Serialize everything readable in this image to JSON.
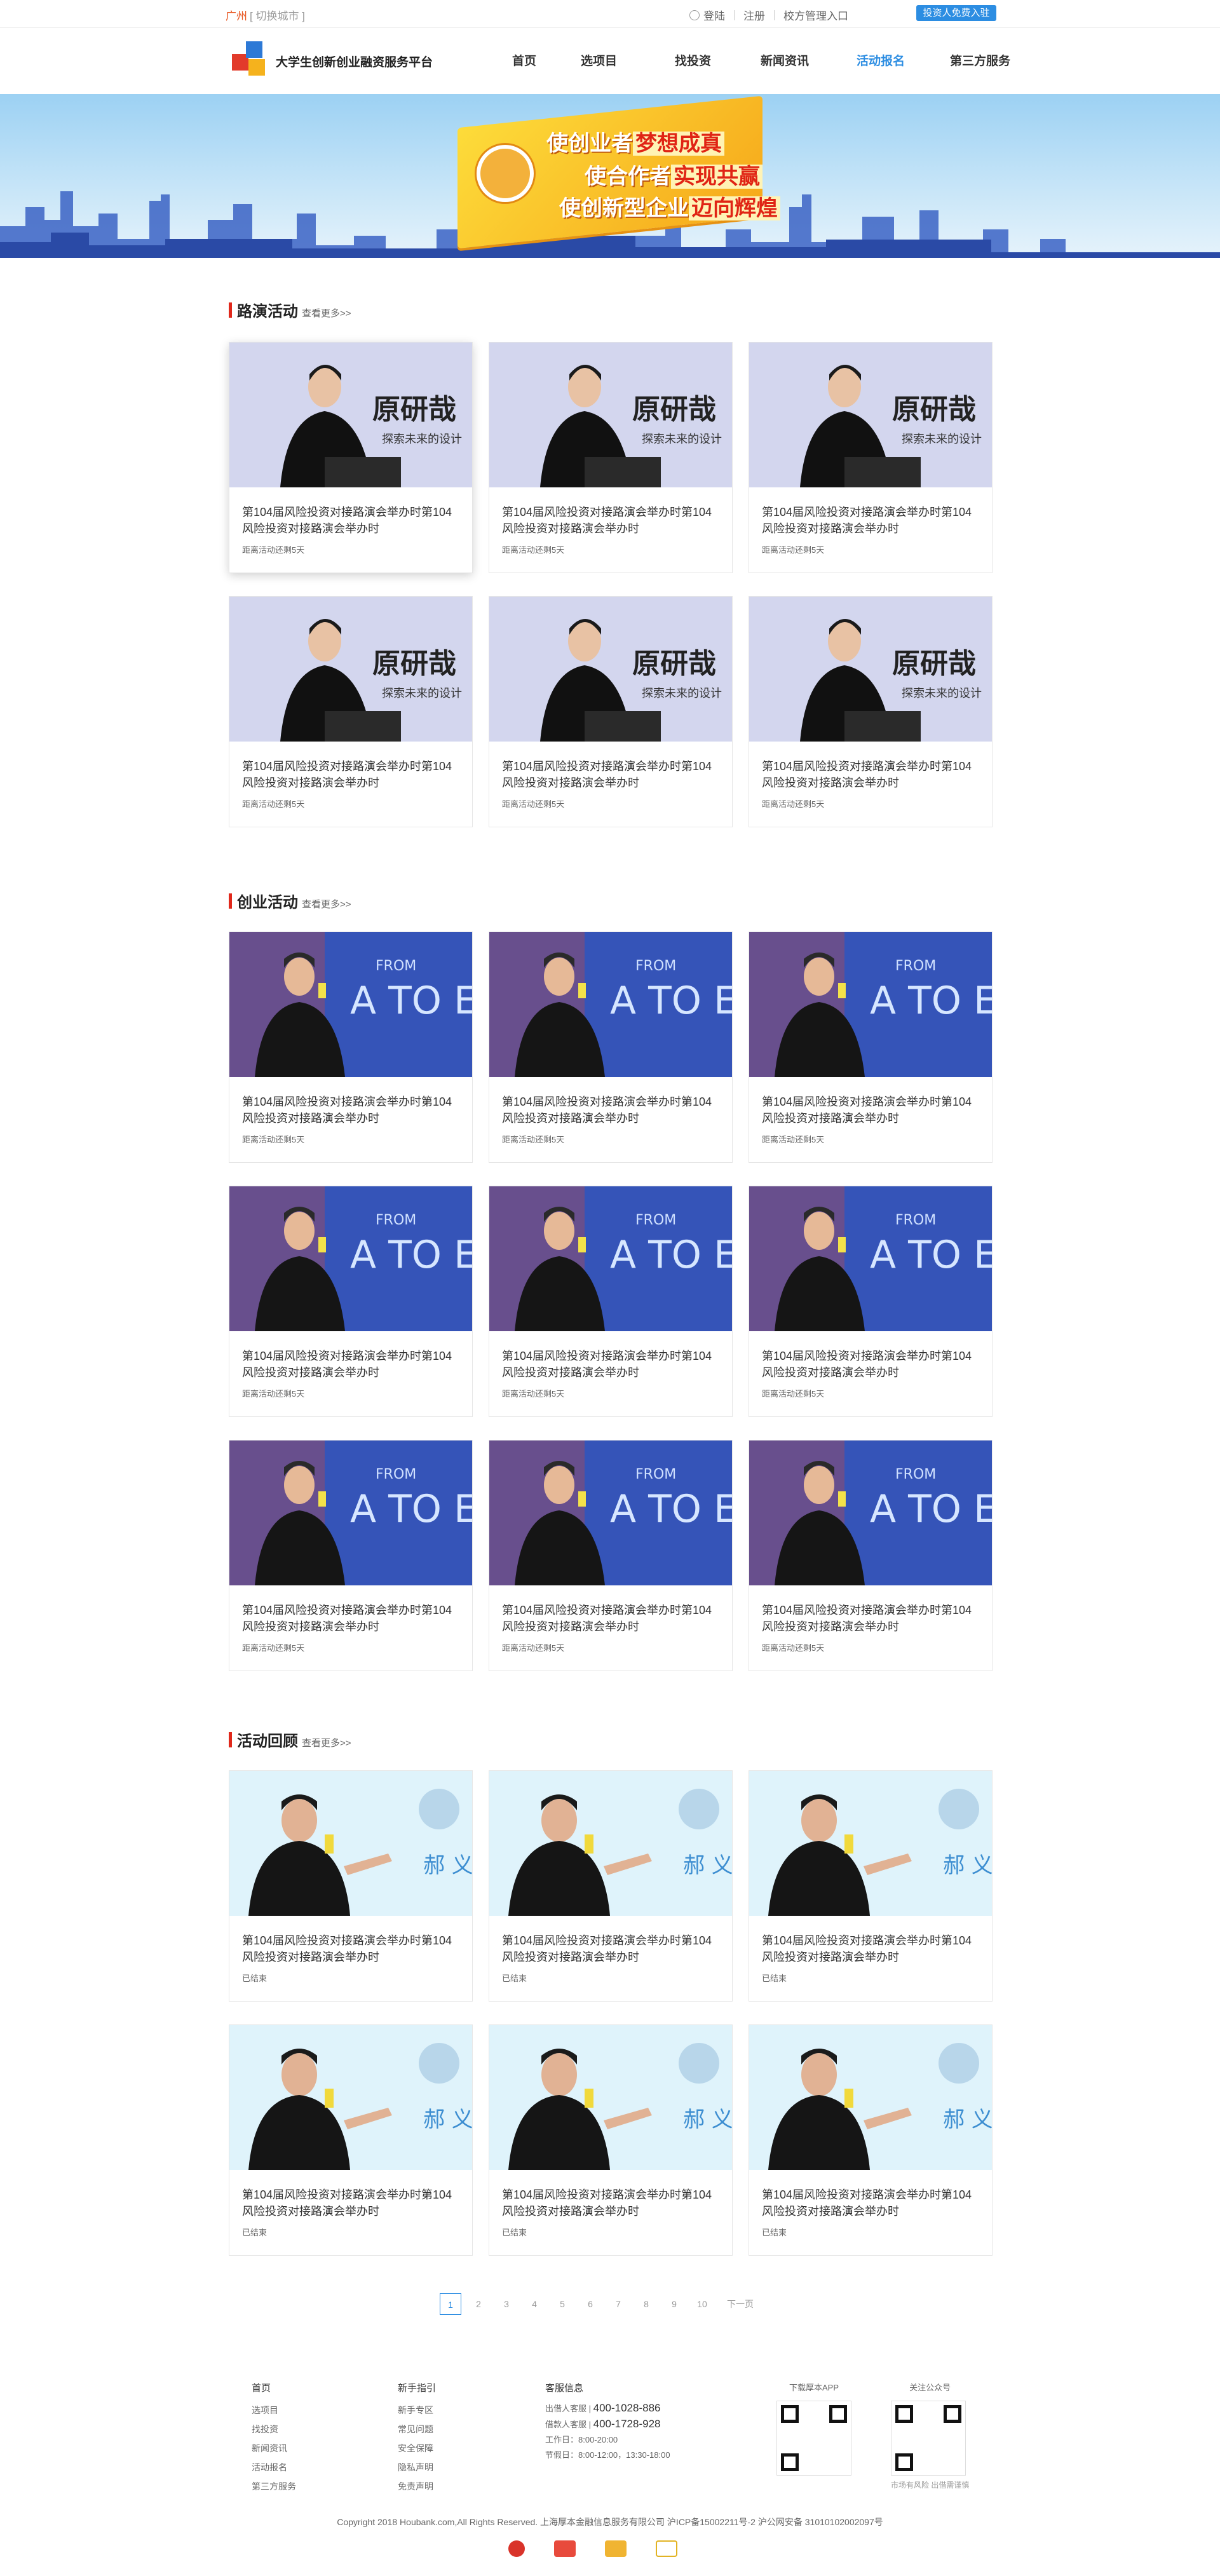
{
  "topbar": {
    "city": "广州",
    "switch_city": "[ 切换城市 ]",
    "login": "登陆",
    "register": "注册",
    "admin": "校方管理入口",
    "invest_button": "投资人免费入驻"
  },
  "header": {
    "site_title": "大学生创新创业融资服务平台",
    "nav": [
      "首页",
      "选项目",
      "找投资",
      "新闻资讯",
      "活动报名",
      "第三方服务"
    ],
    "active_nav": "活动报名"
  },
  "banner": {
    "line1_a": "使创业者",
    "line1_b": "梦想成真",
    "line2_a": "使合作者",
    "line2_b": "实现共赢",
    "line3_a": "使创新型企业",
    "line3_b": "迈向辉煌"
  },
  "sections": [
    {
      "title": "路演活动",
      "more": "查看更多>>",
      "cards": [
        {
          "title": "第104届风险投资对接路演会举办时第104风险投资对接路演会举办时",
          "status": "距离活动还剩5天"
        },
        {
          "title": "第104届风险投资对接路演会举办时第104风险投资对接路演会举办时",
          "status": "距离活动还剩5天"
        },
        {
          "title": "第104届风险投资对接路演会举办时第104风险投资对接路演会举办时",
          "status": "距离活动还剩5天"
        },
        {
          "title": "第104届风险投资对接路演会举办时第104风险投资对接路演会举办时",
          "status": "距离活动还剩5天"
        },
        {
          "title": "第104届风险投资对接路演会举办时第104风险投资对接路演会举办时",
          "status": "距离活动还剩5天"
        },
        {
          "title": "第104届风险投资对接路演会举办时第104风险投资对接路演会举办时",
          "status": "距离活动还剩5天"
        }
      ]
    },
    {
      "title": "创业活动",
      "more": "查看更多>>",
      "cards": [
        {
          "title": "第104届风险投资对接路演会举办时第104风险投资对接路演会举办时",
          "status": "距离活动还剩5天"
        },
        {
          "title": "第104届风险投资对接路演会举办时第104风险投资对接路演会举办时",
          "status": "距离活动还剩5天"
        },
        {
          "title": "第104届风险投资对接路演会举办时第104风险投资对接路演会举办时",
          "status": "距离活动还剩5天"
        },
        {
          "title": "第104届风险投资对接路演会举办时第104风险投资对接路演会举办时",
          "status": "距离活动还剩5天"
        },
        {
          "title": "第104届风险投资对接路演会举办时第104风险投资对接路演会举办时",
          "status": "距离活动还剩5天"
        },
        {
          "title": "第104届风险投资对接路演会举办时第104风险投资对接路演会举办时",
          "status": "距离活动还剩5天"
        },
        {
          "title": "第104届风险投资对接路演会举办时第104风险投资对接路演会举办时",
          "status": "距离活动还剩5天"
        },
        {
          "title": "第104届风险投资对接路演会举办时第104风险投资对接路演会举办时",
          "status": "距离活动还剩5天"
        },
        {
          "title": "第104届风险投资对接路演会举办时第104风险投资对接路演会举办时",
          "status": "距离活动还剩5天"
        }
      ]
    },
    {
      "title": "活动回顾",
      "more": "查看更多>>",
      "cards": [
        {
          "title": "第104届风险投资对接路演会举办时第104风险投资对接路演会举办时",
          "status": "已结束"
        },
        {
          "title": "第104届风险投资对接路演会举办时第104风险投资对接路演会举办时",
          "status": "已结束"
        },
        {
          "title": "第104届风险投资对接路演会举办时第104风险投资对接路演会举办时",
          "status": "已结束"
        },
        {
          "title": "第104届风险投资对接路演会举办时第104风险投资对接路演会举办时",
          "status": "已结束"
        },
        {
          "title": "第104届风险投资对接路演会举办时第104风险投资对接路演会举办时",
          "status": "已结束"
        },
        {
          "title": "第104届风险投资对接路演会举办时第104风险投资对接路演会举办时",
          "status": "已结束"
        }
      ]
    }
  ],
  "photo_text": {
    "a_big": "原研哉",
    "a_small": "探索未来的设计",
    "b_from": "FROM",
    "b_big": "A TO E",
    "c_big": "郝 义"
  },
  "pagination": {
    "pages": [
      "1",
      "2",
      "3",
      "4",
      "5",
      "6",
      "7",
      "8",
      "9",
      "10"
    ],
    "current": "1",
    "next": "下一页"
  },
  "footer": {
    "col1": {
      "heading": "首页",
      "links": [
        "选项目",
        "找投资",
        "新闻资讯",
        "活动报名",
        "第三方服务"
      ]
    },
    "col2": {
      "heading": "新手指引",
      "links": [
        "新手专区",
        "常见问题",
        "安全保障",
        "隐私声明",
        "免责声明"
      ]
    },
    "col3": {
      "heading": "客服信息",
      "investor_label": "出借人客服 |",
      "investor_phone": "400-1028-886",
      "borrower_label": "借款人客服 |",
      "borrower_phone": "400-1728-928",
      "workday": "工作日：8:00-20:00",
      "holiday": "节假日：8:00-12:00，13:30-18:00"
    },
    "app": {
      "label": "下载厚本APP"
    },
    "wechat": {
      "label": "关注公众号",
      "note": "市场有风险 出借需谨慎"
    },
    "copyright": "Copyright 2018 Houbank.com,All Rights Reserved.  上海厚本金融信息服务有限公司  沪ICP备15002211号-2  沪公网安备 31010102002097号"
  }
}
